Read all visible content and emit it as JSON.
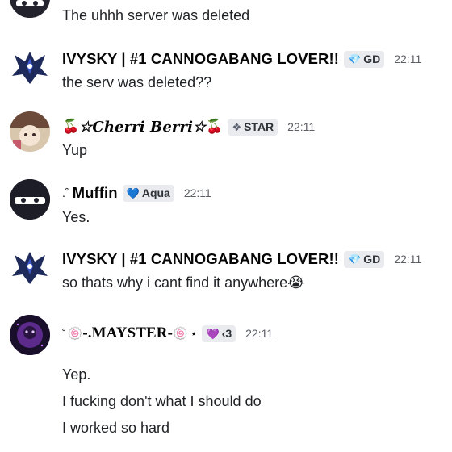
{
  "messages": [
    {
      "id": "m0",
      "lines": [
        "The uhhh server was deleted"
      ]
    },
    {
      "id": "m1",
      "username": "IVYSKY | #1 CANNOGABANG LOVER!!",
      "tag": "GD",
      "tag_icon": "gem-icon",
      "time": "22:11",
      "lines": [
        "the serv was deleted??"
      ]
    },
    {
      "id": "m2",
      "username": "☆Cherri Berri☆",
      "tag": "STAR",
      "tag_icon": "star-badge-icon",
      "time": "22:11",
      "lines": [
        "Yup"
      ]
    },
    {
      "id": "m3",
      "username_prefix": ".˚",
      "username": "Muffin",
      "tag": "Aqua",
      "tag_icon": "heart-icon",
      "time": "22:11",
      "lines": [
        "Yes."
      ]
    },
    {
      "id": "m4",
      "username": "IVYSKY | #1 CANNOGABANG LOVER!!",
      "tag": "GD",
      "tag_icon": "gem-icon",
      "time": "22:11",
      "lines": [
        "so thats why i cant find it anywhere"
      ],
      "line_emoji": "😭"
    },
    {
      "id": "m5",
      "username_prefix": "˚",
      "username": "-.MAYSTER-",
      "username_suffix": "⋆",
      "tag": "‹3",
      "tag_icon": "heart-icon",
      "time": "22:11",
      "lines": [
        "Yep.",
        "I fucking don't what I should do",
        "I worked so hard"
      ]
    }
  ],
  "colors": {
    "background": "#ffffff",
    "text": "#1f2125",
    "tag_bg": "#eaebee",
    "time": "#5c5e66"
  }
}
